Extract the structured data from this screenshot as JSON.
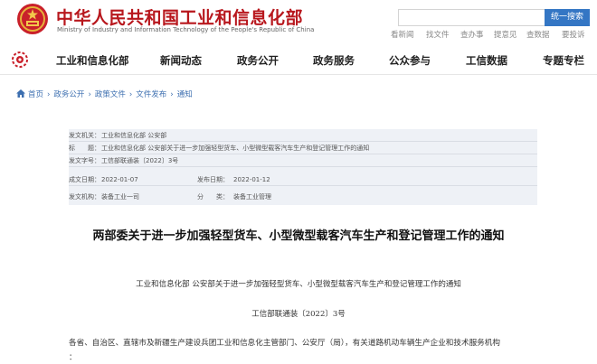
{
  "header": {
    "site_name_cn": "中华人民共和国工业和信息化部",
    "site_name_en": "Ministry of Industry and Information Technology of the People's Republic of China",
    "search_placeholder": "",
    "search_button": "统一搜索",
    "quick_links": [
      "看新闻",
      "找文件",
      "查办事",
      "提意见",
      "查数据",
      "要投诉"
    ]
  },
  "nav": {
    "items": [
      "工业和信息化部",
      "新闻动态",
      "政务公开",
      "政务服务",
      "公众参与",
      "工信数据",
      "专题专栏"
    ]
  },
  "breadcrumb": [
    "首页",
    "政务公开",
    "政策文件",
    "文件发布",
    "通知"
  ],
  "doc_info": {
    "issuer_label": "发文机关：",
    "issuer": "工业和信息化部 公安部",
    "title_label": "标　　题：",
    "title": "工业和信息化部 公安部关于进一步加强轻型货车、小型微型载客汽车生产和登记管理工作的通知",
    "number_label": "发文字号：",
    "number": "工信部联通装〔2022〕3号",
    "date_label": "成文日期：",
    "date": "2022-01-07",
    "pubdate_label": "发布日期：",
    "pubdate": "2022-01-12",
    "org_label": "发文机构：",
    "org": "装备工业一司",
    "category_label": "分　　类：",
    "category": "装备工业管理"
  },
  "article": {
    "title": "两部委关于进一步加强轻型货车、小型微型载客汽车生产和登记管理工作的通知",
    "subtitle": "工业和信息化部 公安部关于进一步加强轻型货车、小型微型载客汽车生产和登记管理工作的通知",
    "doc_number": "工信部联通装〔2022〕3号",
    "salutation": "各省、自治区、直辖市及新疆生产建设兵团工业和信息化主管部门、公安厅（局），有关道路机动车辆生产企业和技术服务机构",
    "salutation_end": "："
  },
  "colors": {
    "brand_red": "#b8171d",
    "search_blue": "#3476c4",
    "link_blue": "#3d6fb0",
    "info_bg": "#eef1f6"
  }
}
